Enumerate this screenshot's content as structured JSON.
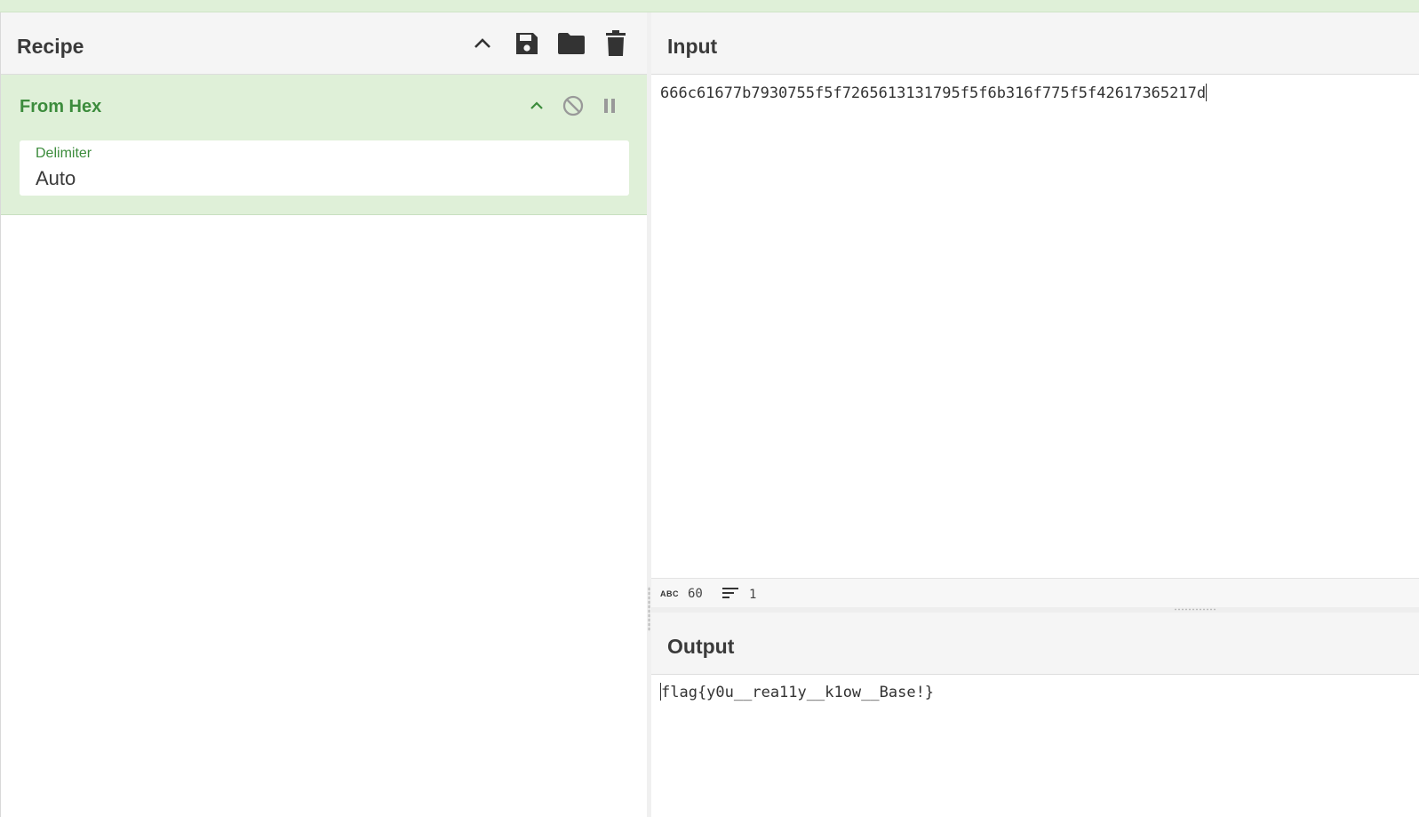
{
  "recipe": {
    "title": "Recipe",
    "icons": [
      "chevron-up-icon",
      "save-icon",
      "folder-icon",
      "trash-icon"
    ],
    "operations": [
      {
        "name": "From Hex",
        "icons": [
          "chevron-up-icon",
          "disable-icon",
          "pause-icon"
        ],
        "args": [
          {
            "label": "Delimiter",
            "value": "Auto"
          }
        ]
      }
    ]
  },
  "input": {
    "title": "Input",
    "text": "666c61677b7930755f5f7265613131795f5f6b316f775f5f42617365217d",
    "status": {
      "chars": "60",
      "lines": "1"
    }
  },
  "output": {
    "title": "Output",
    "text": "flag{y0u__rea11y__k1ow__Base!}"
  },
  "colors": {
    "accent_green": "#3c8c3c",
    "op_background": "#dff0d8"
  }
}
